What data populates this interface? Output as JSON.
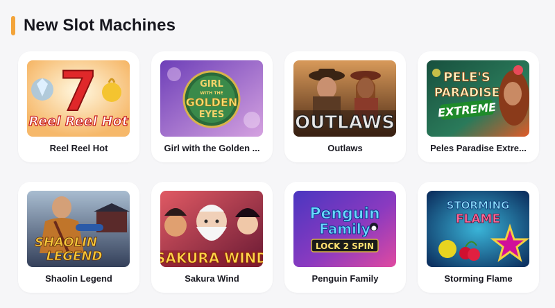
{
  "section": {
    "title": "New Slot Machines",
    "accent_color": "#f3a43a"
  },
  "games": [
    {
      "label": "Reel Reel Hot",
      "icon": "reel-reel-hot-thumbnail",
      "art": {
        "line1": "7",
        "line2": "Reel Reel Hot",
        "bg": [
          "#ffd9a0",
          "#e9742a"
        ]
      }
    },
    {
      "label": "Girl with the Golden ...",
      "icon": "girl-with-golden-eyes-thumbnail",
      "art": {
        "line1": "GIRL",
        "line2": "WITH THE",
        "line3": "GOLDEN",
        "line4": "EYES",
        "bg": [
          "#7e4fc4",
          "#c98bd8"
        ]
      }
    },
    {
      "label": "Outlaws",
      "icon": "outlaws-thumbnail",
      "art": {
        "line1": "OUTLAWS",
        "bg": [
          "#6a3a22",
          "#c87940"
        ]
      }
    },
    {
      "label": "Peles Paradise Extre...",
      "icon": "peles-paradise-thumbnail",
      "art": {
        "line1": "PELE'S",
        "line2": "PARADISE",
        "line3": "EXTREME",
        "bg": [
          "#1d5b4e",
          "#d85a2a"
        ]
      }
    },
    {
      "label": "Shaolin Legend",
      "icon": "shaolin-legend-thumbnail",
      "art": {
        "line1": "SHAOLIN",
        "line2": "LEGEND",
        "bg": [
          "#8aa0b8",
          "#3d4a5e"
        ]
      }
    },
    {
      "label": "Sakura Wind",
      "icon": "sakura-wind-thumbnail",
      "art": {
        "line1": "SAKURA WIND",
        "bg": [
          "#d94a5c",
          "#7d2040"
        ]
      }
    },
    {
      "label": "Penguin Family",
      "icon": "penguin-family-thumbnail",
      "art": {
        "line1": "Penguin",
        "line2": "Family",
        "line3": "LOCK 2 SPIN",
        "bg": [
          "#5a3cc8",
          "#d94aa8"
        ]
      }
    },
    {
      "label": "Storming Flame",
      "icon": "storming-flame-thumbnail",
      "art": {
        "line1": "STORMING",
        "line2": "FLAME",
        "bg": [
          "#1c7ea8",
          "#0c3a6a"
        ]
      }
    }
  ]
}
